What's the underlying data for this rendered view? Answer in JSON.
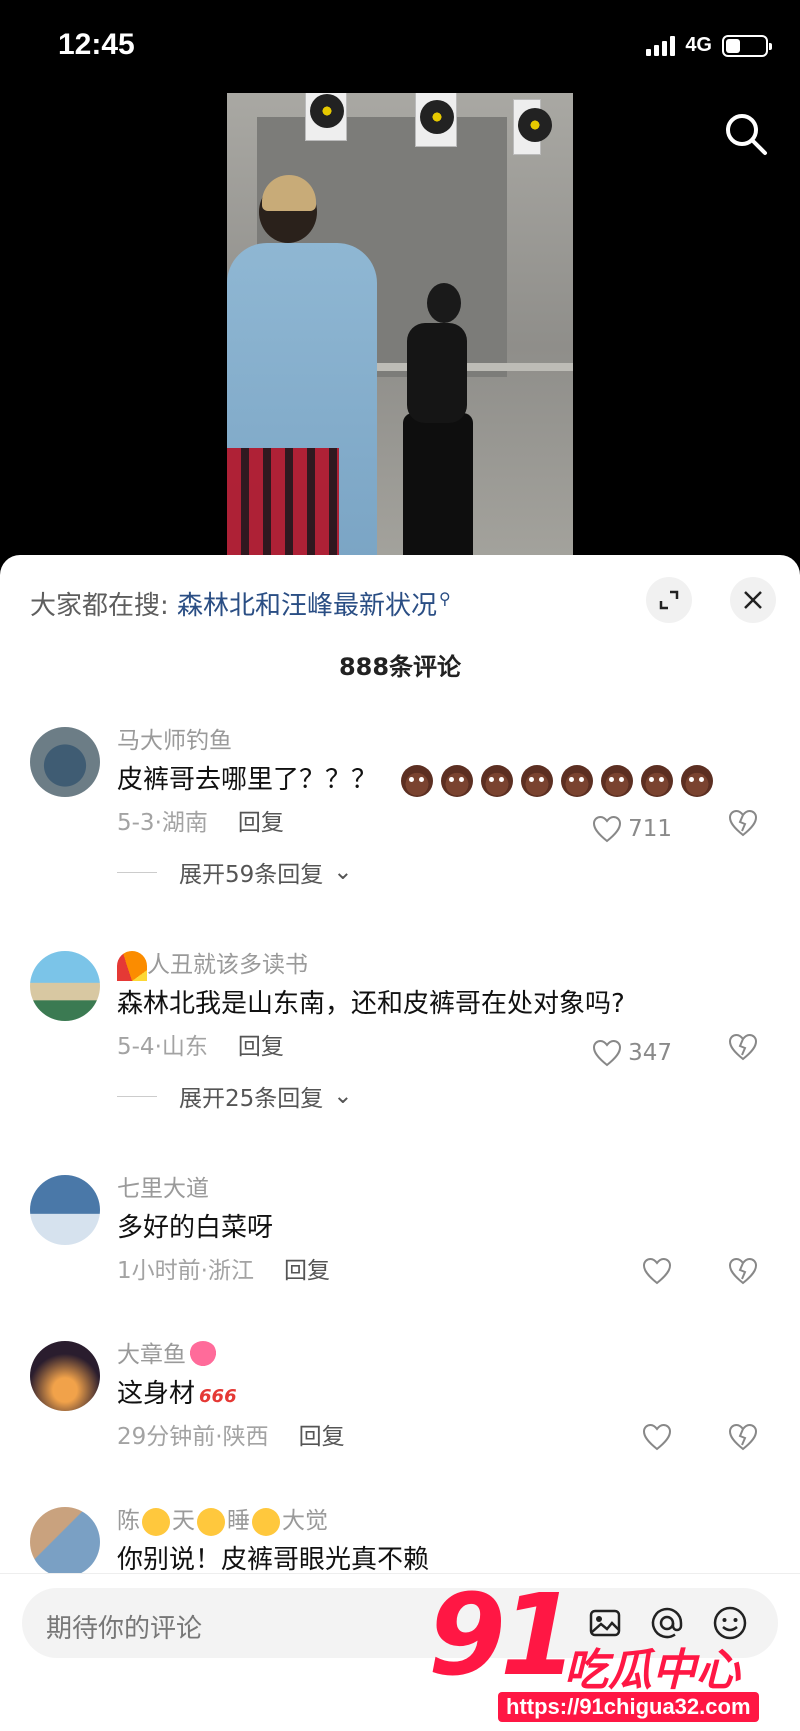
{
  "status_bar": {
    "time": "12:45",
    "network": "4G"
  },
  "sheet": {
    "hot_search_prefix": "大家都在搜:",
    "hot_search_keyword": "森林北和汪峰最新状况",
    "comment_count": "888条评论"
  },
  "comments": [
    {
      "name": "马大师钓鱼",
      "text": "皮裤哥去哪里了？？？",
      "emoji": "poo-emoji",
      "emoji_count": 8,
      "date": "5-3",
      "region": "湖南",
      "reply": "回复",
      "likes": "711",
      "expand": "展开59条回复"
    },
    {
      "name": "人丑就该多读书",
      "name_prefix_emoji": "rainbow-emoji",
      "text": "森林北我是山东南，还和皮裤哥在处对象吗?",
      "date": "5-4",
      "region": "山东",
      "reply": "回复",
      "likes": "347",
      "expand": "展开25条回复"
    },
    {
      "name": "七里大道",
      "text": "多好的白菜呀",
      "date": "1小时前",
      "region": "浙江",
      "reply": "回复"
    },
    {
      "name": "大章鱼",
      "name_suffix_emoji": "octopus-emoji",
      "text": "这身材",
      "text_suffix_emoji": "666-emoji",
      "date": "29分钟前",
      "region": "陕西",
      "reply": "回复"
    },
    {
      "name_parts": [
        "陈",
        "天",
        "睡",
        "大觉"
      ],
      "text": "你别说！皮裤哥眼光真不赖"
    }
  ],
  "input": {
    "placeholder": "期待你的评论"
  },
  "watermark": {
    "number": "91",
    "brand": "吃瓜中心",
    "url": "https://91chigua32.com"
  },
  "colors": {
    "keyword": "#2a4e84",
    "watermark": "#ff1744"
  }
}
